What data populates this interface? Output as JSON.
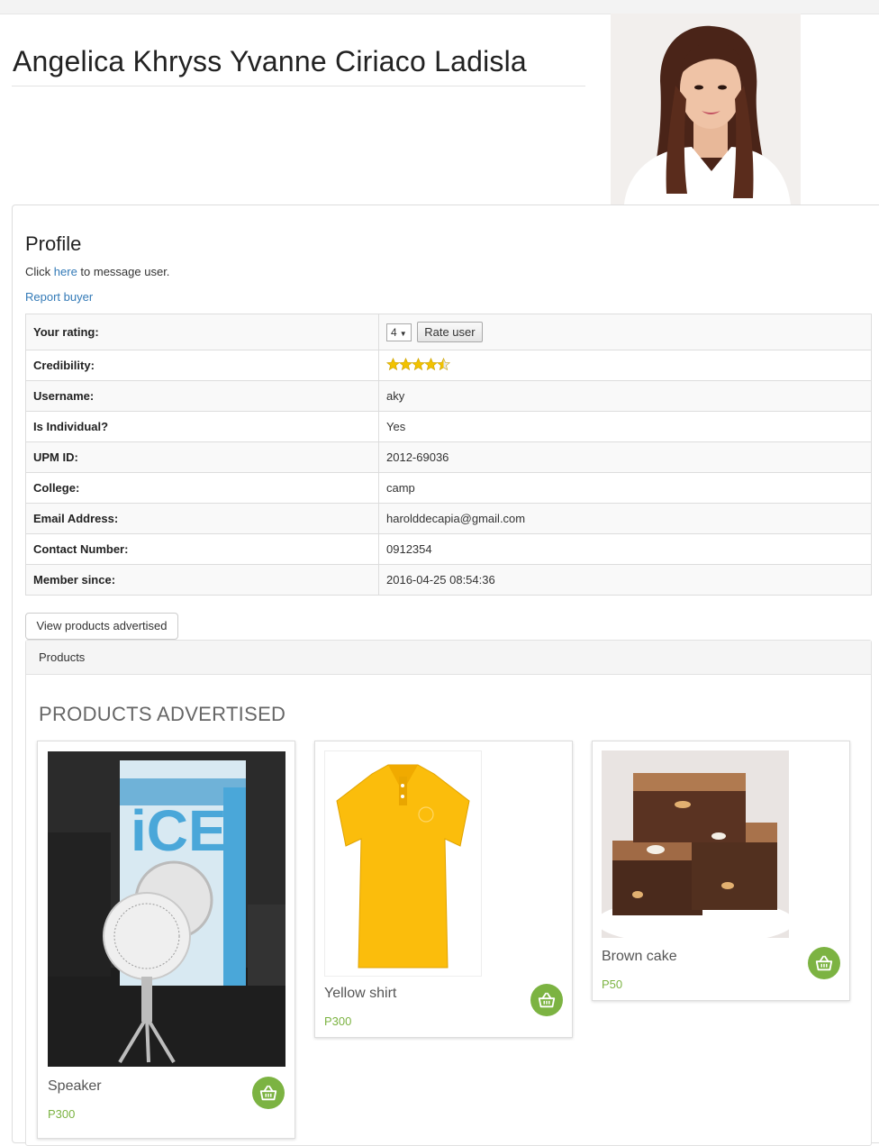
{
  "header": {
    "name": "Angelica Khryss Yvanne Ciriaco Ladisla"
  },
  "profile": {
    "heading": "Profile",
    "message_prefix": "Click ",
    "message_link": "here",
    "message_suffix": " to message user.",
    "report_link": "Report buyer",
    "rating": {
      "label": "Your rating:",
      "selected": "4",
      "button": "Rate user"
    },
    "credibility": {
      "label": "Credibility:",
      "stars": 4.5,
      "max": 5
    },
    "fields": [
      {
        "label": "Username:",
        "value": "aky"
      },
      {
        "label": "Is Individual?",
        "value": "Yes"
      },
      {
        "label": "UPM ID:",
        "value": "2012-69036"
      },
      {
        "label": "College:",
        "value": "camp"
      },
      {
        "label": "Email Address:",
        "value": "harolddecapia@gmail.com"
      },
      {
        "label": "Contact Number:",
        "value": "0912354"
      },
      {
        "label": "Member since:",
        "value": "2016-04-25 08:54:36"
      }
    ]
  },
  "products": {
    "toggle_button": "View products advertised",
    "panel_heading": "Products",
    "title": "PRODUCTS ADVERTISED",
    "items": [
      {
        "name": "Speaker",
        "price": "P300"
      },
      {
        "name": "Yellow shirt",
        "price": "P300"
      },
      {
        "name": "Brown cake",
        "price": "P50"
      }
    ]
  },
  "colors": {
    "link": "#337ab7",
    "price": "#7cb342",
    "cart_button": "#7cb342",
    "star": "#f2c200"
  }
}
